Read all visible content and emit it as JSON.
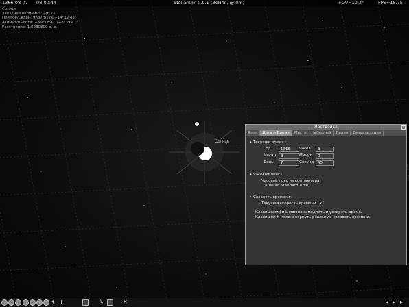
{
  "topbar": {
    "date": "1366-08-07",
    "time": "08:00:44",
    "app": "Stellarium 0.9.1 (Земля, @ 0m)",
    "fov": "FOV=10.2°",
    "fps": "FPS=15.75"
  },
  "object_info": {
    "name": "Солнце",
    "lines": [
      "Звёздная величина: -26.71",
      "Прямое/Склон: 9h37m17s/+14°12'43\"",
      "Азимут/Высота: +59°18'41\"/+8°39'47\"",
      "Расстояние: 1.0280800 а. е."
    ]
  },
  "sky": {
    "sun_label": "Солнце",
    "colors": {
      "background": "#000000",
      "sun": "#ffffff",
      "moon_disc": "#111111"
    }
  },
  "dialog": {
    "title": "Настройка",
    "close": "×",
    "tabs": [
      "Язык",
      "Дата и Время",
      "Место",
      "Небесный",
      "Видео",
      "Визуализация"
    ],
    "active_tab": "Дата и Время",
    "current_time_heading": "• Текущее время :",
    "fields": {
      "year_label": "Год",
      "year_value": "1366",
      "month_label": "Месяц",
      "month_value": "8",
      "day_label": "День",
      "day_value": "7",
      "hour_label": "Часов",
      "hour_value": "8",
      "minute_label": "Минут",
      "minute_value": "0",
      "second_label": "Секунд",
      "second_value": "45"
    },
    "timezone_heading": "• Часовой пояс :",
    "timezone_option": "• Часовой пояс из компьютера",
    "timezone_name": "(Russian Standard Time)",
    "speed_heading": "• Скорость времени :",
    "speed_current": "• Текущая скорость времени : x1",
    "speed_note_1": "Клавишами J и L можно замедлять и ускорять время.",
    "speed_note_2": "Клавишей K можно вернуть реальную скорость времени."
  },
  "bottombar": {
    "icons": [
      "constellation-lines-icon",
      "constellation-names-icon",
      "equatorial-grid-icon",
      "azimuthal-grid-icon",
      "ground-icon",
      "cardinal-points-icon",
      "atmosphere-icon",
      "nebula-icon",
      "planets-icon",
      "search-icon",
      "configuration-icon",
      "help-icon",
      "quit-icon",
      "time-rewind-icon",
      "time-real-icon",
      "time-forward-icon"
    ]
  }
}
